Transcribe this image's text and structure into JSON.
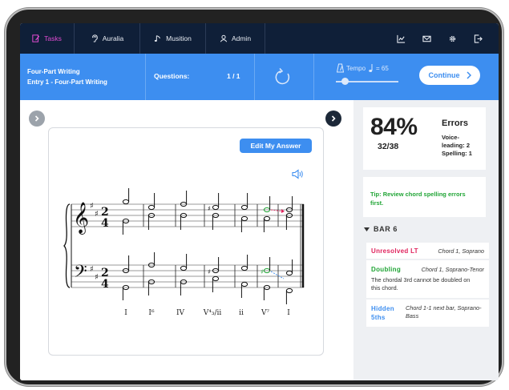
{
  "nav": {
    "tabs": [
      {
        "label": "Tasks",
        "icon": "edit-icon",
        "active": true
      },
      {
        "label": "Auralia",
        "icon": "ear-icon",
        "active": false
      },
      {
        "label": "Musition",
        "icon": "note-icon",
        "active": false
      },
      {
        "label": "Admin",
        "icon": "user-icon",
        "active": false
      }
    ],
    "right_icons": [
      "chart-icon",
      "mail-icon",
      "gear-icon",
      "logout-icon"
    ]
  },
  "task": {
    "title": "Four-Part Writing",
    "entry": "Entry 1 - Four-Part Writing",
    "questions_label": "Questions:",
    "questions_value": "1 / 1",
    "tempo_label": "Tempo",
    "tempo_value": "= 65",
    "tempo_level": 0.1,
    "continue_label": "Continue"
  },
  "score": {
    "edit_label": "Edit My Answer",
    "roman_numerals": [
      "I",
      "I⁶",
      "IV",
      "V⁴₃/ii",
      "ii",
      "V⁷",
      "I"
    ]
  },
  "results": {
    "percent": "84%",
    "fraction": "32/38",
    "errors_title": "Errors",
    "errors_voice": "Voice-leading: 2",
    "errors_spelling": "Spelling: 1",
    "tip": "Tip: Review chord spelling errors first.",
    "bar_label": "BAR 6",
    "errors": [
      {
        "type": "Unresolved LT",
        "location": "Chord 1, Soprano",
        "color": "#e0245e",
        "description": ""
      },
      {
        "type": "Doubling",
        "location": "Chord 1, Soprano-Tenor",
        "color": "#21a536",
        "description": "The chordal 3rd cannot be doubled on this chord."
      },
      {
        "type": "Hidden 5ths",
        "location": "Chord 1-1 next bar, Soprano-Bass",
        "color": "#3d8ef0",
        "description": ""
      }
    ]
  },
  "colors": {
    "nav_bg": "#0f1f38",
    "accent_blue": "#3d8ef0",
    "active_tab": "#e04bd1",
    "tip_green": "#21a536"
  }
}
